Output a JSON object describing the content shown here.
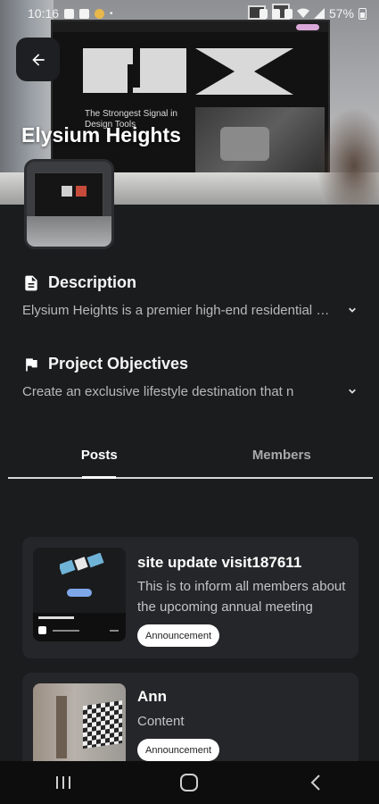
{
  "status_bar": {
    "time": "10:16",
    "battery": "57%"
  },
  "hero": {
    "title": "Elysium Heights",
    "monitor_headline": "The Strongest Signal in Design Tools"
  },
  "description": {
    "heading": "Description",
    "text": "Elysium Heights is a premier high-end residential development"
  },
  "objectives": {
    "heading": "Project Objectives",
    "text": "Create an exclusive lifestyle destination that n"
  },
  "tabs": [
    {
      "label": "Posts",
      "active": true
    },
    {
      "label": "Members",
      "active": false
    }
  ],
  "posts": [
    {
      "title": "site update visit187611",
      "text": "This is to inform all members about the upcoming annual meeting",
      "tag": "Announcement"
    },
    {
      "title": "Ann",
      "text": "Content",
      "tag": "Announcement"
    }
  ],
  "icons": {
    "back": "arrow-left-icon",
    "description": "document-icon",
    "objectives": "flag-icon",
    "expand": "chevron-down-icon",
    "nav_recents": "recents-icon",
    "nav_home": "home-icon",
    "nav_back": "back-chevron-icon"
  },
  "colors": {
    "background": "#1b1c1e",
    "card": "#252629",
    "badge": "#ffffff",
    "accent": "#d9a7d8"
  }
}
